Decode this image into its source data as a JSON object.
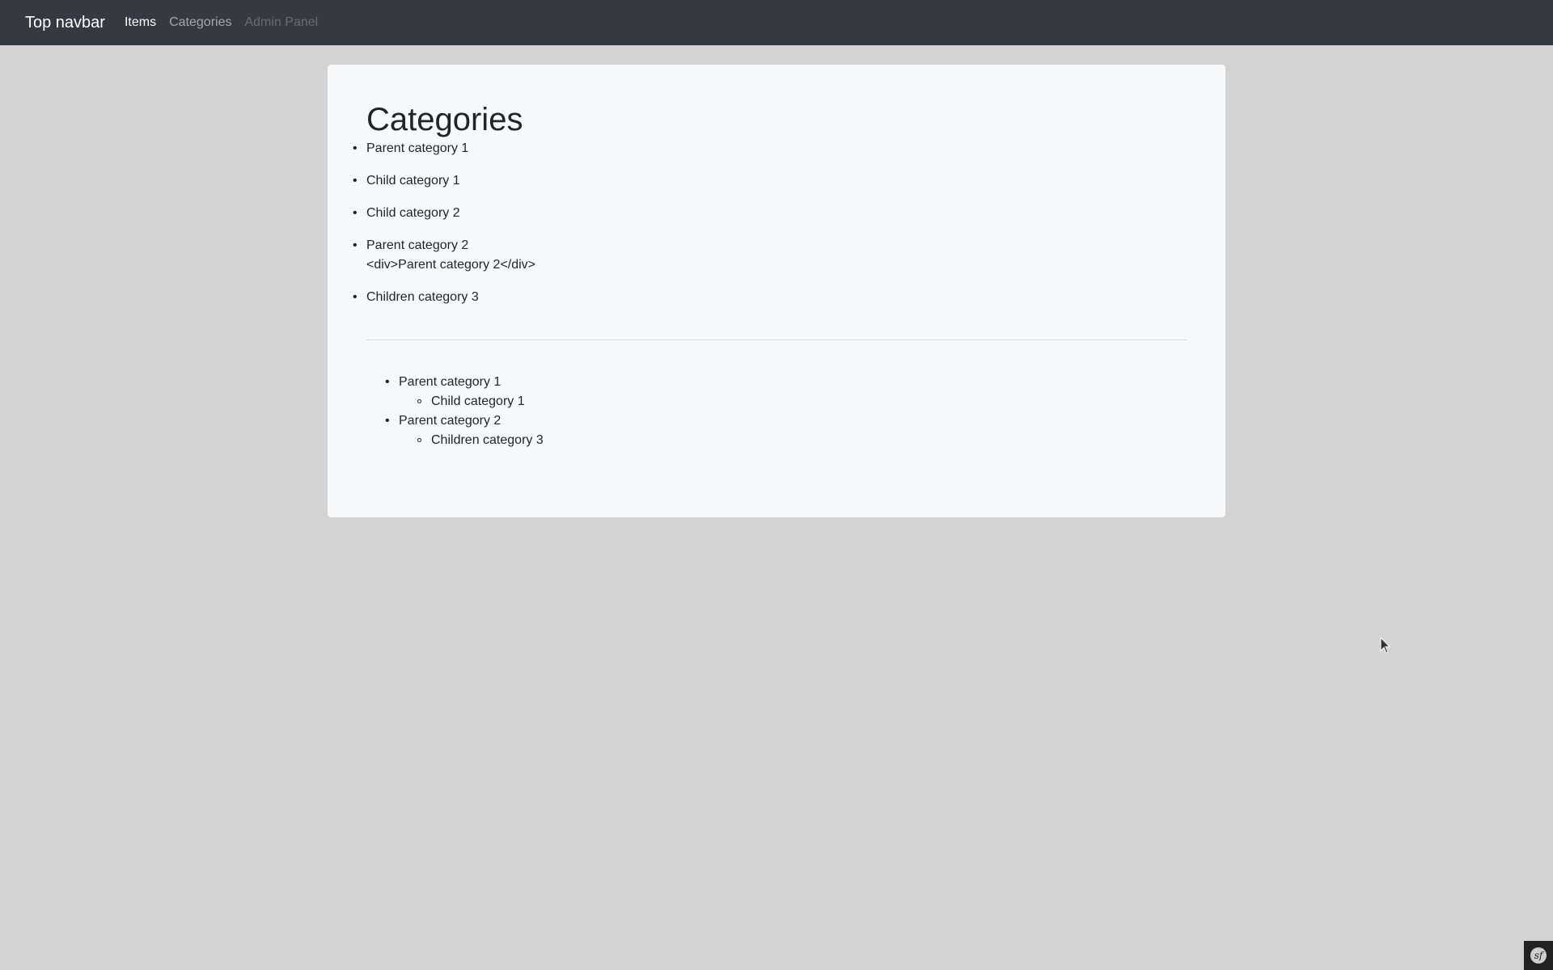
{
  "navbar": {
    "brand": "Top navbar",
    "links": [
      {
        "label": "Items",
        "state": "active"
      },
      {
        "label": "Categories",
        "state": "normal"
      },
      {
        "label": "Admin Panel",
        "state": "disabled"
      }
    ]
  },
  "main": {
    "title": "Categories",
    "flat_list": [
      {
        "label": "Parent category 1"
      },
      {
        "label": "Child category 1"
      },
      {
        "label": "Child category 2"
      },
      {
        "label": "Parent category 2",
        "raw_html_text": "<div>Parent category 2</div>"
      },
      {
        "label": "Children category 3"
      }
    ],
    "tree": [
      {
        "label": "Parent category 1",
        "children": [
          "Child category 1"
        ]
      },
      {
        "label": "Parent category 2",
        "children": [
          "Children category 3"
        ]
      }
    ]
  },
  "debug_toolbar": {
    "icon": "symfony-logo-icon",
    "logo_text": "sf"
  },
  "colors": {
    "navbar_bg": "#343a40",
    "page_bg": "#d3d3d3",
    "card_bg": "#f8f9fa"
  }
}
